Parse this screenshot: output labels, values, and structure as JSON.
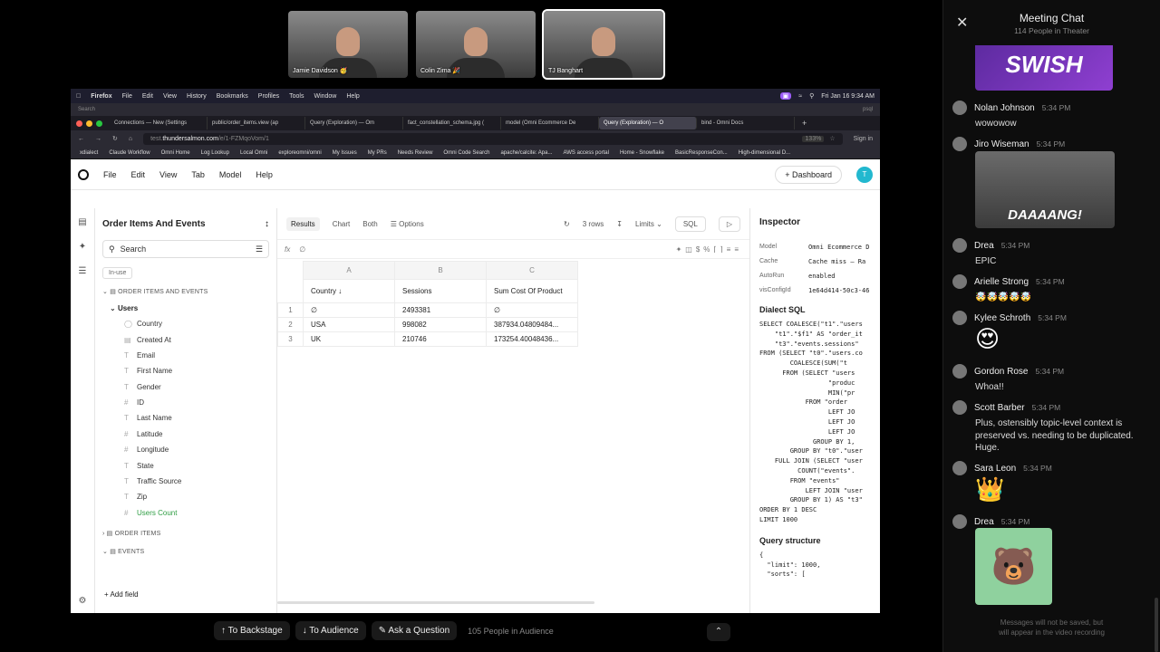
{
  "participants": [
    {
      "name": "Jamie Davidson 🥳"
    },
    {
      "name": "Colin Zima 🎉"
    },
    {
      "name": "TJ Banghart"
    }
  ],
  "mac_menu": {
    "app": "Firefox",
    "items": [
      "File",
      "Edit",
      "View",
      "History",
      "Bookmarks",
      "Profiles",
      "Tools",
      "Window",
      "Help"
    ],
    "clock": "Fri Jan 16  9:34 AM"
  },
  "browser": {
    "search_placeholder": "Search",
    "psql": "psql",
    "tabs": [
      "Connections — New (Settings",
      "public/order_items.view (ap",
      "Query (Exploration) — Om",
      "fact_constellation_schema.jpg (",
      "model (Omni Ecommerce De",
      "Query (Exploration) — O",
      "bind - Omni Docs"
    ],
    "url_prefix": "test.",
    "url_domain": "thundersalmon.com",
    "url_path": "/e/1-FZMqoVom/1",
    "zoom": "133%",
    "sign_in": "Sign in",
    "bookmarks": [
      "xdialect",
      "Claude Workflow",
      "Omni Home",
      "Log Lookup",
      "Local Omni",
      "exploreomni/omni",
      "My Issues",
      "My PRs",
      "Needs Review",
      "Omni Code Search",
      "apache/calcite: Apa...",
      "AWS access portal",
      "Home - Snowflake",
      "BasicResponseCon...",
      "High-dimensional D..."
    ]
  },
  "app": {
    "menu": [
      "File",
      "Edit",
      "View",
      "Tab",
      "Model",
      "Help"
    ],
    "dashboard_btn": "+ Dashboard",
    "avatar": "T"
  },
  "fields_panel": {
    "title": "Order Items And Events",
    "search_placeholder": "Search",
    "inuse": "In-use",
    "group1": "ORDER ITEMS AND EVENTS",
    "view": "Users",
    "fields": [
      "Country",
      "Created At",
      "Email",
      "First Name",
      "Gender",
      "ID",
      "Last Name",
      "Latitude",
      "Longitude",
      "State",
      "Traffic Source",
      "Zip",
      "Users Count"
    ],
    "group2": "ORDER ITEMS",
    "group3": "EVENTS",
    "add_field": "+ Add field"
  },
  "results": {
    "tabs": [
      "Results",
      "Chart",
      "Both"
    ],
    "options": "Options",
    "rows": "3 rows",
    "limits": "Limits",
    "sql": "SQL",
    "fx": "∅",
    "columns": [
      "A",
      "B",
      "C"
    ],
    "headers": [
      "Country ↓",
      "Sessions",
      "Sum Cost Of Product"
    ],
    "data": [
      [
        "1",
        "∅",
        "2493381",
        "∅"
      ],
      [
        "2",
        "USA",
        "998082",
        "387934.04809484..."
      ],
      [
        "3",
        "UK",
        "210746",
        "173254.40048436..."
      ]
    ]
  },
  "inspector": {
    "title": "Inspector",
    "kv": [
      {
        "k": "Model",
        "v": "Omni Ecommerce D"
      },
      {
        "k": "Cache",
        "v": "Cache miss — Ra"
      },
      {
        "k": "AutoRun",
        "v": "enabled"
      },
      {
        "k": "visConfigId",
        "v": "1e64d414-50c3-46"
      }
    ],
    "dialect_title": "Dialect SQL",
    "sql": "SELECT COALESCE(\"t1\".\"users\n    \"t1\".\"$f1\" AS \"order_it\n    \"t3\".\"events.sessions\"\nFROM (SELECT \"t0\".\"users.co\n        COALESCE(SUM(\"t\n      FROM (SELECT \"users\n                  \"produc\n                  MIN(\"pr\n            FROM \"order\n                  LEFT JO\n                  LEFT JO\n                  LEFT JO\n              GROUP BY 1,\n        GROUP BY \"t0\".\"user\n    FULL JOIN (SELECT \"user\n          COUNT(\"events\".\n        FROM \"events\"\n            LEFT JOIN \"user\n        GROUP BY 1) AS \"t3\"\nORDER BY 1 DESC\nLIMIT 1000",
    "structure_title": "Query structure",
    "structure": "{\n  \"limit\": 1000,\n  \"sorts\": ["
  },
  "bottom": {
    "backstage": "↑  To Backstage",
    "audience": "↓  To Audience",
    "ask": "✎  Ask a Question",
    "count": "105 People in Audience"
  },
  "chat": {
    "title": "Meeting Chat",
    "subtitle": "114 People in Theater",
    "gif1": "SWISH",
    "gif2": "DAAAANG!",
    "messages": [
      {
        "name": "Nolan Johnson",
        "time": "5:34 PM",
        "text": "wowowow"
      },
      {
        "name": "Jiro Wiseman",
        "time": "5:34 PM",
        "text": ""
      },
      {
        "name": "Drea",
        "time": "5:34 PM",
        "text": "EPIC"
      },
      {
        "name": "Arielle Strong",
        "time": "5:34 PM",
        "text": "🤯🤯🤯🤯🤯"
      },
      {
        "name": "Kylee Schroth",
        "time": "5:34 PM",
        "text": "😍"
      },
      {
        "name": "Gordon Rose",
        "time": "5:34 PM",
        "text": "Whoa!!"
      },
      {
        "name": "Scott Barber",
        "time": "5:34 PM",
        "text": "Plus, ostensibly topic-level context is preserved vs. needing to be duplicated.  Huge."
      },
      {
        "name": "Sara Leon",
        "time": "5:34 PM",
        "text": "👑"
      },
      {
        "name": "Drea",
        "time": "5:34 PM",
        "text": ""
      }
    ],
    "footnote1": "Messages will not be saved, but",
    "footnote2": "will appear in the video recording"
  }
}
